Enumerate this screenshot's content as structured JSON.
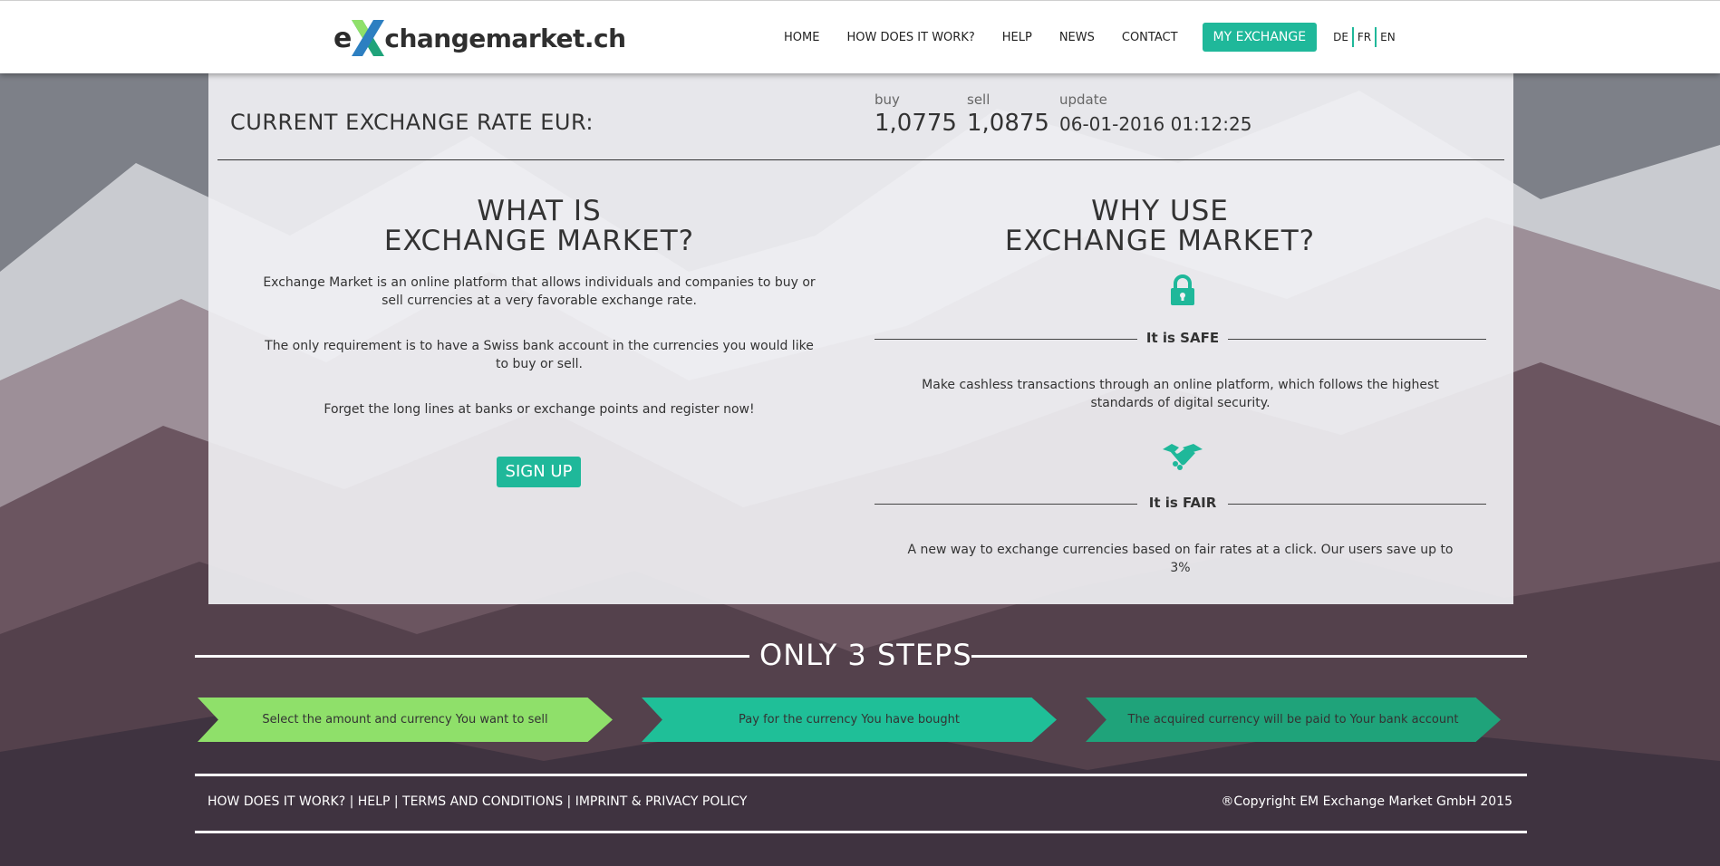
{
  "header": {
    "logo": {
      "prefix": "e",
      "rest": "changemarket.ch"
    },
    "nav": [
      "HOME",
      "HOW DOES IT WORK?",
      "HELP",
      "NEWS",
      "CONTACT"
    ],
    "cta": "MY EXCHANGE",
    "languages": [
      "DE",
      "FR",
      "EN"
    ]
  },
  "rates": {
    "title": "CURRENT EXCHANGE RATE EUR:",
    "buy_label": "buy",
    "buy_value": "1,0775",
    "sell_label": "sell",
    "sell_value": "1,0875",
    "update_label": "update",
    "update_value": "06-01-2016 01:12:25"
  },
  "what": {
    "title_line1": "WHAT IS",
    "title_line2": "EXCHANGE MARKET?",
    "p1": "Exchange Market is an online platform that allows individuals and companies to buy or sell currencies at a very favorable exchange rate.",
    "p2": "The only requirement is to have a Swiss bank account in the currencies you would like to buy or sell.",
    "p3": "Forget the long lines at banks or exchange points and register now!",
    "signup": "SIGN UP"
  },
  "why": {
    "title_line1": "WHY USE",
    "title_line2": "EXCHANGE MARKET?",
    "safe_label": "It is SAFE",
    "safe_text": "Make cashless transactions through an online platform, which follows the highest standards of digital security.",
    "fair_label": "It is FAIR",
    "fair_text": "A new way to exchange currencies based on fair rates at a click. Our users save up to 3%"
  },
  "steps": {
    "title": "ONLY 3 STEPS",
    "items": [
      {
        "text": "Select the amount and currency You want to sell",
        "color": "#8fe06a"
      },
      {
        "text": "Pay for the currency You have bought",
        "color": "#1fbf98"
      },
      {
        "text": "The acquired currency will be paid to Your bank account",
        "color": "#1fa37a"
      }
    ]
  },
  "footer": {
    "links": [
      "HOW DOES IT WORK?",
      "HELP",
      "TERMS AND CONDITIONS",
      "IMPRINT & PRIVACY POLICY"
    ],
    "copyright": "®Copyright EM Exchange Market GmbH 2015"
  },
  "colors": {
    "accent": "#1fb89a"
  }
}
